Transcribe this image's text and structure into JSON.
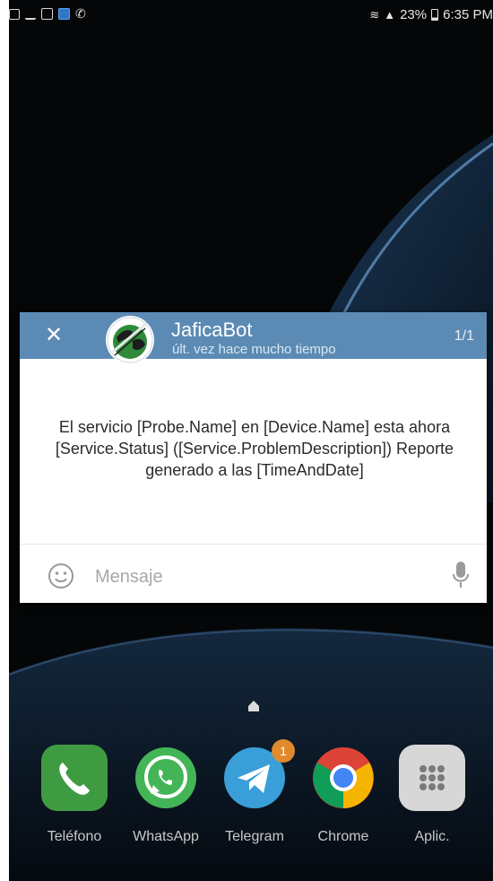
{
  "status_bar": {
    "battery": "23%",
    "time": "6:35 PM"
  },
  "popup": {
    "close_symbol": "✕",
    "bot_name": "JaficaBot",
    "last_seen": "últ. vez hace mucho tiempo",
    "counter": "1/1",
    "message": "El servicio [Probe.Name] en [Device.Name] esta ahora [Service.Status] ([Service.ProblemDescription]) Reporte generado a las [TimeAndDate]",
    "input_placeholder": "Mensaje"
  },
  "dock": {
    "apps": [
      {
        "label": "Teléfono",
        "icon": "phone-icon"
      },
      {
        "label": "WhatsApp",
        "icon": "whatsapp-icon"
      },
      {
        "label": "Telegram",
        "icon": "telegram-icon",
        "badge": "1"
      },
      {
        "label": "Chrome",
        "icon": "chrome-icon"
      },
      {
        "label": "Aplic.",
        "icon": "apps-grid-icon"
      }
    ]
  },
  "colors": {
    "header": "#5b8bb4",
    "badge": "#e08a2c",
    "phone": "#4caf50",
    "whatsapp": "#3fbf5a",
    "telegram": "#3a9fd8"
  }
}
